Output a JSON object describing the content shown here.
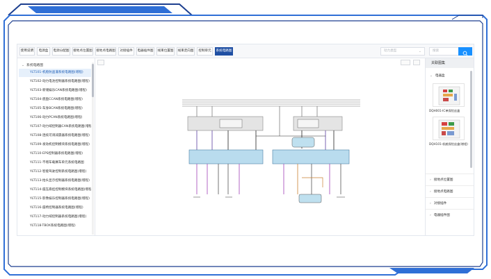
{
  "tabs": [
    {
      "label": "使用说明",
      "active": false
    },
    {
      "label": "电源盒",
      "active": false
    },
    {
      "label": "电源分配图",
      "active": false
    },
    {
      "label": "接地点位置图",
      "active": false
    },
    {
      "label": "接地点电路图",
      "active": false
    },
    {
      "label": "对接插件",
      "active": false
    },
    {
      "label": "电器插件图",
      "active": false
    },
    {
      "label": "线束位置图",
      "active": false
    },
    {
      "label": "线束走向图",
      "active": false
    },
    {
      "label": "控制单元",
      "active": false
    },
    {
      "label": "系统电路图",
      "active": true
    }
  ],
  "filter": {
    "placeholder": "动力类型"
  },
  "search": {
    "placeholder": "搜索",
    "icon": "search-icon"
  },
  "sidebar": {
    "root": "系统电路图",
    "items": [
      "YLT101-机舱防盗灌系统电路图(增程)",
      "YLT102-动力电池控制器系统电路图(增程)",
      "YLT103-新储娱乐CAN系统电路图(增程)",
      "YLT104-底盘CCAN系统电路图(增程)",
      "YLT105-车身BCAN系统电路图(增程)",
      "YLT106-动力PCAN系统电路图(增程)",
      "YLT107-动力域控制器CAN系统电路图(增程)",
      "YLT108-连续可调减震器系统电路图(增程)",
      "YLT109-发动机控制模块系统电路图(增程)",
      "YLT110-EPS控制器系统电路图(增程)",
      "YLT111-不增车载赛车单元系统电路图",
      "YLT112-智能驾驶控制系统电路图(增程)",
      "YLT113-抬头显示控制器系统电路图(增程)",
      "YLT114-座压悬挂控制模块系统电路图(增程)",
      "YLT115-影像娱乐控制器系统电路图(增程)",
      "YLT116-座椅控制器系统电路图(增程)",
      "YLT117-动力域控制器系统电路图(增程)",
      "YLT118-TBOX系统电路图(增程)"
    ],
    "selected_index": 0
  },
  "right_panel": {
    "title": "关联图集",
    "sections": [
      {
        "label": "电器盒",
        "expanded": true
      },
      {
        "label": "接地点位置图",
        "expanded": false
      },
      {
        "label": "接地点电路图",
        "expanded": false
      },
      {
        "label": "对接插件",
        "expanded": false
      },
      {
        "label": "电器插件图",
        "expanded": false
      }
    ],
    "thumbnails": [
      {
        "label": "DQH001-IC单保险丝盒"
      },
      {
        "label": "DQH101-机舱保险丝盒(增程)"
      }
    ]
  },
  "colors": {
    "frame_blue": "#2f6fd6",
    "frame_dark": "#1c3f8f",
    "tab_active": "#1f4fa3",
    "search_btn": "#1890ff",
    "module_fill": "#b9dcee"
  }
}
